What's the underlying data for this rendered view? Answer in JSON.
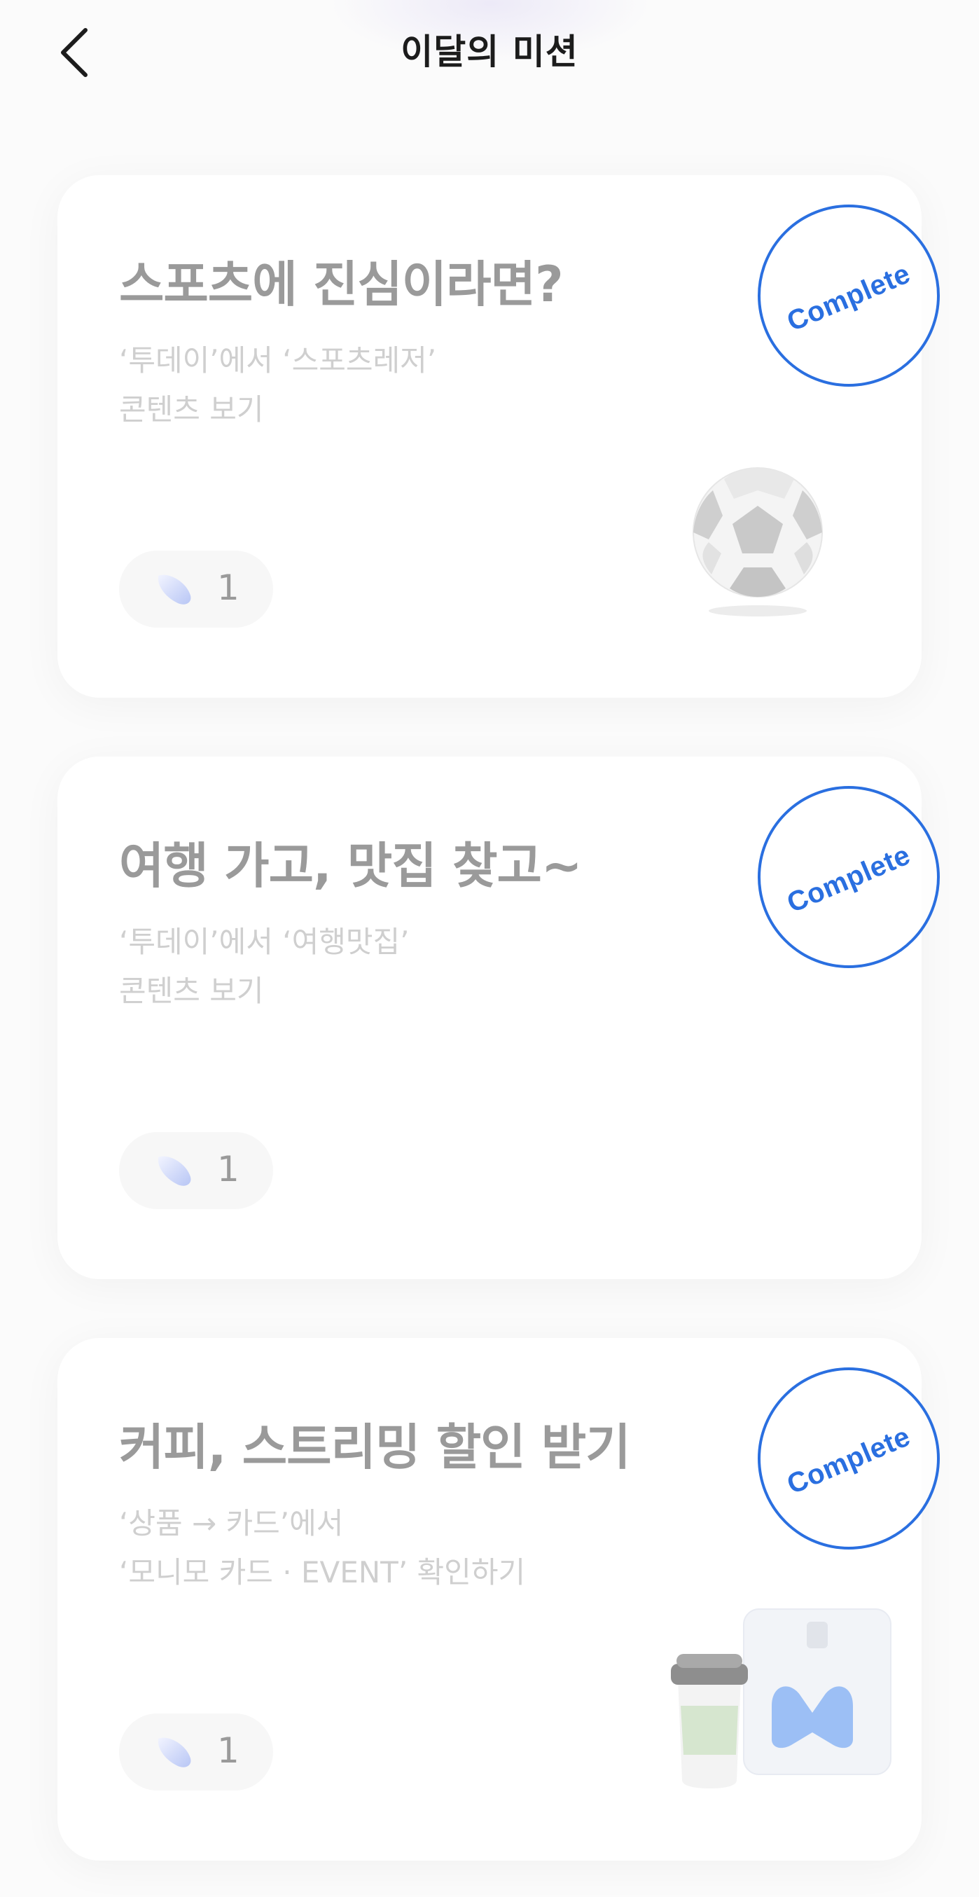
{
  "header": {
    "title": "이달의 미션",
    "back_icon": "chevron-left-icon"
  },
  "missions": [
    {
      "title": "스포츠에 진심이라면?",
      "desc_line1": "‘투데이’에서 ‘스포츠레저’",
      "desc_line2": "콘텐츠 보기",
      "reward_count": "1",
      "stamp": "Complete",
      "illustration": "soccer-ball-icon"
    },
    {
      "title": "여행 가고, 맛집 찾고~",
      "desc_line1": "‘투데이’에서 ‘여행맛집’",
      "desc_line2": "콘텐츠 보기",
      "reward_count": "1",
      "stamp": "Complete"
    },
    {
      "title": "커피, 스트리밍 할인 받기",
      "desc_line1": "‘상품 → 카드’에서",
      "desc_line2": "‘모니모 카드 · EVENT’ 확인하기",
      "reward_count": "1",
      "stamp": "Complete",
      "illustration": "coffee-cup-and-card-icon"
    }
  ],
  "colors": {
    "stamp_blue": "#2a6fe0",
    "title_gray": "#9a9a9a",
    "desc_gray": "#cfcfcf"
  }
}
